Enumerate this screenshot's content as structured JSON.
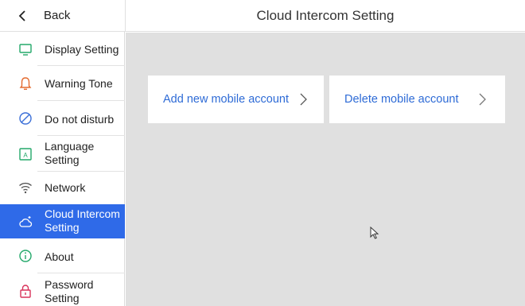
{
  "header": {
    "back_label": "Back",
    "title": "Cloud Intercom Setting"
  },
  "sidebar": {
    "items": [
      {
        "label": "Display Setting",
        "icon": "monitor-icon",
        "active": false
      },
      {
        "label": "Warning Tone",
        "icon": "bell-icon",
        "active": false
      },
      {
        "label": "Do not disturb",
        "icon": "do-not-disturb-icon",
        "active": false
      },
      {
        "label": "Language Setting",
        "icon": "language-icon",
        "active": false
      },
      {
        "label": "Network",
        "icon": "wifi-icon",
        "active": false
      },
      {
        "label": "Cloud Intercom Setting",
        "icon": "cloud-icon",
        "active": true
      },
      {
        "label": "About",
        "icon": "info-icon",
        "active": false
      },
      {
        "label": "Password Setting",
        "icon": "lock-icon",
        "active": false
      }
    ]
  },
  "main": {
    "cards": [
      {
        "label": "Add new mobile account"
      },
      {
        "label": "Delete mobile account"
      }
    ]
  },
  "colors": {
    "accent": "#2f6ae8",
    "link": "#2e6bd6",
    "content_bg": "#e0e0e0"
  }
}
